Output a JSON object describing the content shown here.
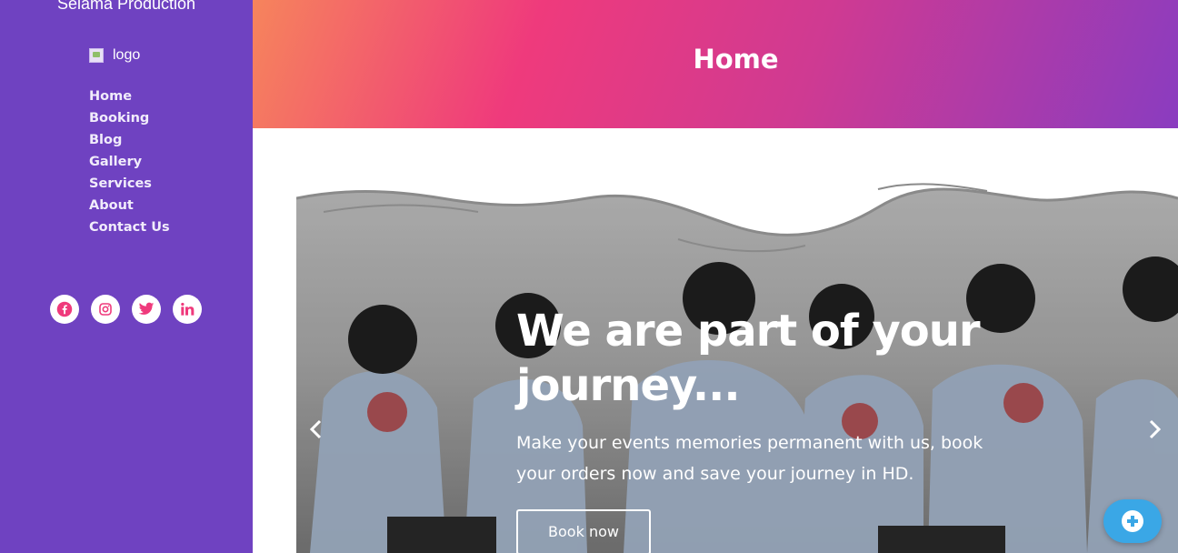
{
  "sidebar": {
    "brand": "Selama Production",
    "logo_alt": "logo",
    "nav": [
      {
        "label": "Home"
      },
      {
        "label": "Booking"
      },
      {
        "label": "Blog"
      },
      {
        "label": "Gallery"
      },
      {
        "label": "Services"
      },
      {
        "label": "About"
      },
      {
        "label": "Contact Us"
      }
    ],
    "socials": [
      {
        "icon": "facebook-icon"
      },
      {
        "icon": "instagram-icon"
      },
      {
        "icon": "twitter-icon"
      },
      {
        "icon": "linkedin-icon"
      }
    ]
  },
  "header": {
    "title": "Home"
  },
  "hero": {
    "title": "We are part of your journey...",
    "subtitle": "Make your events memories permanent with us, book your orders now and save your journey in HD.",
    "button_label": "Book now"
  },
  "colors": {
    "sidebar": "#6f42c1",
    "accent": "#ef3a7c",
    "fab": "#3aa7e6"
  }
}
